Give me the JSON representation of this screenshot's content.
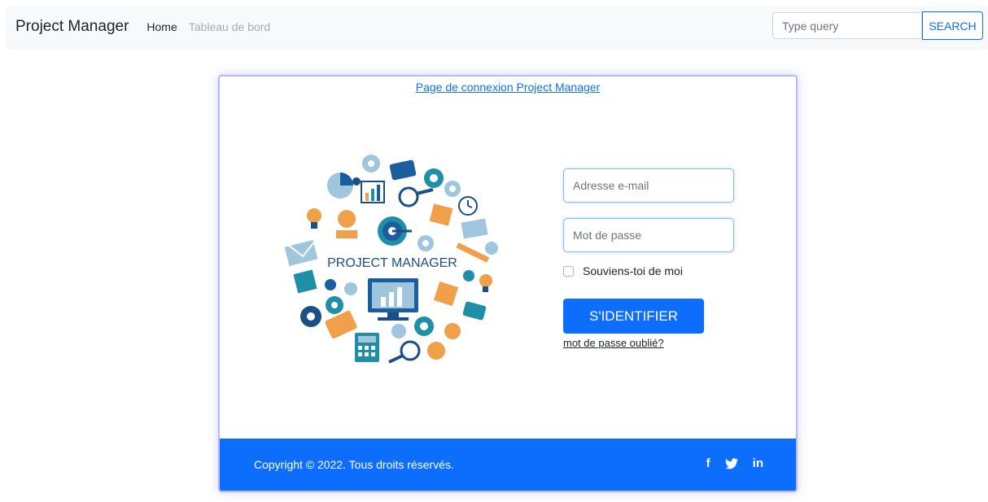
{
  "navbar": {
    "brand": "Project Manager",
    "links": [
      "Home",
      "Tableau de bord"
    ],
    "search_placeholder": "Type query",
    "search_label": "SEARCH"
  },
  "login": {
    "title": "Page de connexion Project Manager",
    "illustration_caption": "PROJECT MANAGER",
    "email_placeholder": "Adresse e-mail",
    "password_placeholder": "Mot de passe",
    "remember_label": "Souviens-toi de moi",
    "submit_label": "S'IDENTIFIER",
    "forgot_label": "mot de passe oublié?"
  },
  "footer": {
    "copyright": "Copyright © 2022. Tous droits réservés.",
    "socials": [
      {
        "icon": "facebook-icon",
        "glyph": "f"
      },
      {
        "icon": "twitter-icon",
        "glyph": "t"
      },
      {
        "icon": "linkedin-icon",
        "glyph": "in"
      }
    ]
  },
  "colors": {
    "primary": "#0d6efd",
    "navbar_bg": "#f8f9fa",
    "card_border": "#b8b8f5"
  }
}
